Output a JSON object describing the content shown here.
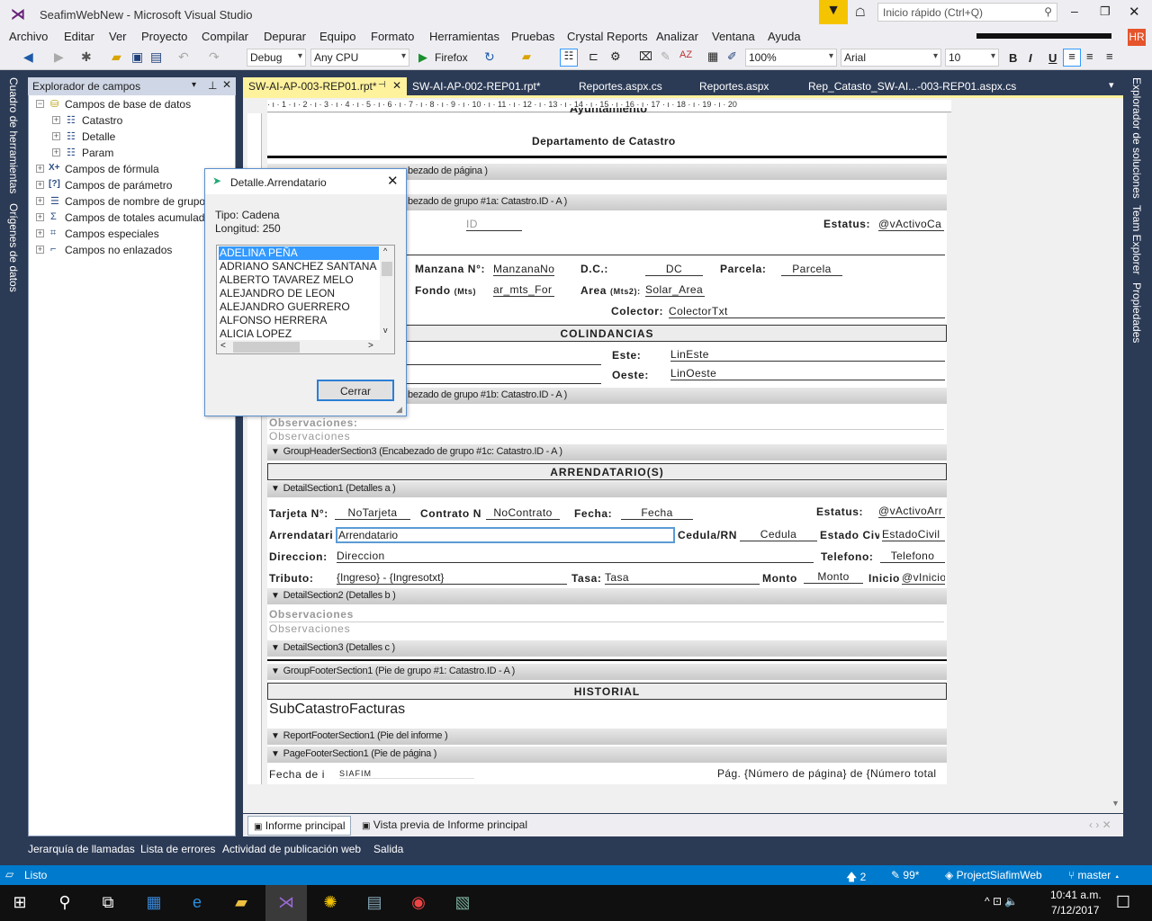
{
  "window": {
    "title": "SeafimWebNew - Microsoft Visual Studio",
    "quick_launch_placeholder": "Inicio rápido (Ctrl+Q)",
    "user_initials": "HR"
  },
  "menu": [
    "Archivo",
    "Editar",
    "Ver",
    "Proyecto",
    "Compilar",
    "Depurar",
    "Equipo",
    "Formato",
    "Herramientas",
    "Pruebas",
    "Crystal Reports",
    "Analizar",
    "Ventana",
    "Ayuda"
  ],
  "toolbar": {
    "config": "Debug",
    "platform": "Any CPU",
    "run_target": "Firefox",
    "zoom": "100%",
    "font": "Arial",
    "font_size": "10",
    "bold": "B",
    "italic": "I",
    "underline": "U"
  },
  "left_vtabs": [
    "Cuadro de herramientas",
    "Orígenes de datos"
  ],
  "right_vtabs": [
    "Explorador de soluciones",
    "Team Explorer",
    "Propiedades"
  ],
  "field_explorer": {
    "title": "Explorador de campos",
    "items": [
      {
        "label": "Campos de base de datos",
        "children": [
          "Catastro",
          "Detalle",
          "Param"
        ]
      },
      {
        "label": "Campos de fórmula"
      },
      {
        "label": "Campos de parámetro"
      },
      {
        "label": "Campos de nombre de grupo"
      },
      {
        "label": "Campos de totales acumulados"
      },
      {
        "label": "Campos especiales"
      },
      {
        "label": "Campos no enlazados"
      }
    ]
  },
  "doc_tabs": [
    "SW-AI-AP-003-REP01.rpt*",
    "SW-AI-AP-002-REP01.rpt*",
    "Reportes.aspx.cs",
    "Reportes.aspx",
    "Rep_Catasto_SW-AI...-003-REP01.aspx.cs"
  ],
  "ruler": "· ı · 1 · ı · 2 · ı · 3 · ı · 4 · ı · 5 · ı · 6 · ı · 7 · ı · 8 · ı · 9 · ı · 10 · ı · 11 · ı · 12 · ı · 13 · ı · 14 · ı · 15 · ı · 16 · ı · 17 · ı · 18 · ı · 19 · ı · 20",
  "report": {
    "header": {
      "title_cut": "Ayuntamiento",
      "dept": "Departamento de Catastro"
    },
    "sections": {
      "page_header": "bezado de página )",
      "group1a": "bezado de grupo #1a: Catastro.ID - A )",
      "group1b": "bezado de grupo #1b: Catastro.ID - A )",
      "group1c": "GroupHeaderSection3 (Encabezado de grupo #1c: Catastro.ID - A )",
      "detail_a": "DetailSection1 (Detalles a )",
      "detail_b": "DetailSection2 (Detalles b )",
      "detail_c": "DetailSection3 (Detalles c )",
      "group_footer": "GroupFooterSection1 (Pie de grupo #1: Catastro.ID - A )",
      "report_footer": "ReportFooterSection1 (Pie del informe )",
      "page_footer": "PageFooterSection1 (Pie de página )"
    },
    "g1a": {
      "id": "ID",
      "estatus_lbl": "Estatus:",
      "estatus": "@vActivoCa",
      "manzana_lbl": "Manzana N°:",
      "manzana": "ManzanaNo",
      "dc_lbl": "D.C.:",
      "dc": "DC",
      "parcela_lbl": "Parcela:",
      "parcela": "Parcela",
      "fondo_lbl": "Fondo",
      "fondo_unit": "(Mts)",
      "fondo": "ar_mts_For",
      "area_lbl": "Area",
      "area_unit": "(Mts2):",
      "area": "Solar_Area",
      "colector_lbl": "Colector:",
      "colector": "ColectorTxt",
      "colindancias": "COLINDANCIAS",
      "este_lbl": "Este:",
      "este": "LinEste",
      "oeste_lbl": "Oeste:",
      "oeste": "LinOeste"
    },
    "g1b": {
      "obs_cut": "Observaciones:",
      "obs": "Observaciones"
    },
    "g1c": {
      "title": "ARRENDATARIO(S)"
    },
    "da": {
      "tarjeta_lbl": "Tarjeta N°:",
      "tarjeta": "NoTarjeta",
      "contrato_lbl": "Contrato N",
      "contrato": "NoContrato",
      "fecha_lbl": "Fecha:",
      "fecha": "Fecha",
      "estatus_lbl": "Estatus:",
      "estatus": "@vActivoArr",
      "arr_lbl": "Arrendatari",
      "arr": "Arrendatario",
      "cedula_lbl": "Cedula/RN",
      "cedula": "Cedula",
      "civil_lbl": "Estado Civ",
      "civil": "EstadoCivil",
      "dir_lbl": "Direccion:",
      "dir": "Direccion",
      "tel_lbl": "Telefono:",
      "tel": "Telefono",
      "trib_lbl": "Tributo:",
      "trib": "{Ingreso} - {Ingresotxt}",
      "tasa_lbl": "Tasa:",
      "tasa": "Tasa",
      "monto_lbl": "Monto",
      "monto": "Monto",
      "inicio_lbl": "Inicio",
      "inicio": "@vInicio"
    },
    "db": {
      "obs_lbl": "Observaciones",
      "obs": "Observaciones"
    },
    "gf": {
      "historial": "HISTORIAL",
      "sub": "SubCatastroFacturas"
    },
    "pf": {
      "fecha": "Fecha de i",
      "siafim": "SIAFIM",
      "pag": "Pág. {Número de página} de {Número total"
    }
  },
  "dialog": {
    "title": "Detalle.Arrendatario",
    "tipo": "Tipo: Cadena",
    "longitud": "Longitud: 250",
    "values": [
      "ADELINA PEÑA",
      "ADRIANO SANCHEZ SANTANA",
      "ALBERTO TAVAREZ MELO",
      "ALEJANDRO DE LEON",
      "ALEJANDRO GUERRERO",
      "ALFONSO HERRERA",
      "ALICIA LOPEZ"
    ],
    "close_label": "Cerrar"
  },
  "bottom_tabs": [
    "Informe principal",
    "Vista previa de Informe principal"
  ],
  "tool_windows": [
    "Jerarquía de llamadas",
    "Lista de errores",
    "Actividad de publicación web",
    "Salida"
  ],
  "status": {
    "text": "Listo",
    "pushes": "2",
    "changes": "99*",
    "project": "ProjectSiafimWeb",
    "branch": "master"
  },
  "taskbar": {
    "time": "10:41 a.m.",
    "date": "7/12/2017"
  },
  "colors": {
    "status_bar": "#007acc",
    "active_tab": "#fff29d",
    "selection": "#3399ff"
  }
}
